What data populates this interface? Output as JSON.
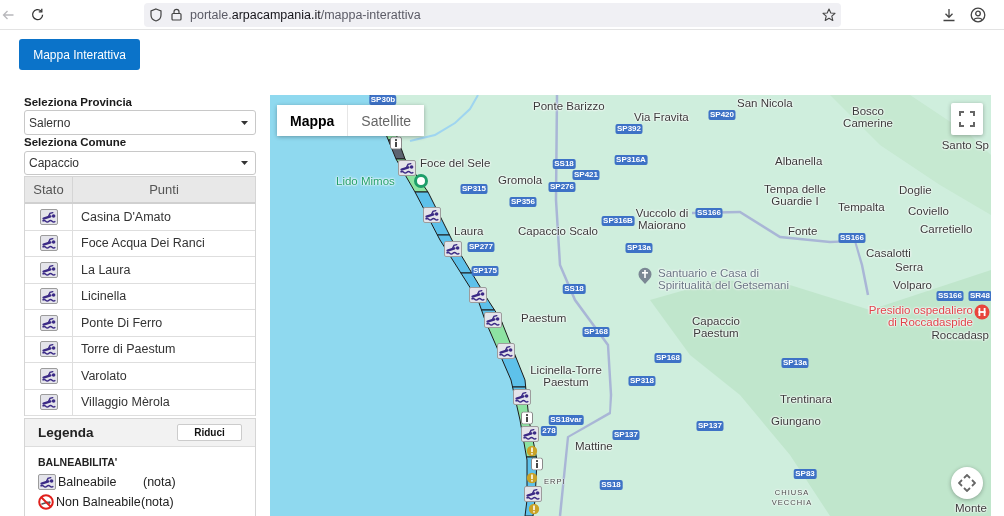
{
  "browser": {
    "back_disabled": true,
    "url": {
      "subdomain": "portale.",
      "domain": "arpacampania.it",
      "path": "/mappa-interattiva"
    }
  },
  "page_button": "Mappa Interattiva",
  "filters": [
    {
      "label": "Seleziona Provincia",
      "value": "Salerno"
    },
    {
      "label": "Seleziona Comune",
      "value": "Capaccio"
    }
  ],
  "table": {
    "columns": [
      "Stato",
      "Punti"
    ],
    "rows": [
      {
        "kind": "balneabile",
        "name": "Casina D'Amato"
      },
      {
        "kind": "balneabile",
        "name": "Foce Acqua Dei Ranci"
      },
      {
        "kind": "balneabile",
        "name": "La Laura"
      },
      {
        "kind": "balneabile",
        "name": "Licinella"
      },
      {
        "kind": "balneabile",
        "name": "Ponte Di Ferro"
      },
      {
        "kind": "balneabile",
        "name": "Torre di Paestum"
      },
      {
        "kind": "balneabile",
        "name": "Varolato"
      },
      {
        "kind": "balneabile",
        "name": "Villaggio Mèrola"
      }
    ]
  },
  "legend": {
    "title": "Legenda",
    "toggle_button": "Riduci",
    "section": "BALNEABILITA'",
    "items": [
      {
        "kind": "balneabile",
        "label": "Balneabile",
        "note": "(nota)"
      },
      {
        "kind": "non_balneabile",
        "label": "Non Balneabile",
        "note": "(nota)"
      }
    ]
  },
  "map": {
    "view_toggle": [
      {
        "label": "Mappa",
        "selected": true
      },
      {
        "label": "Satellite",
        "selected": false
      }
    ],
    "places": [
      {
        "kind": "town",
        "lines": [
          "Ponte Barizzo"
        ]
      },
      {
        "kind": "town",
        "lines": [
          "San Nicola"
        ]
      },
      {
        "kind": "town",
        "lines": [
          "Via Fravita"
        ]
      },
      {
        "kind": "town",
        "lines": [
          "Bosco",
          "Camerine"
        ]
      },
      {
        "kind": "town",
        "lines": [
          "Santo Sp"
        ]
      },
      {
        "kind": "town",
        "lines": [
          "Foce del Sele"
        ]
      },
      {
        "kind": "town",
        "lines": [
          "Albanella"
        ]
      },
      {
        "kind": "beach",
        "lines": [
          "Lido Mimos"
        ]
      },
      {
        "kind": "town",
        "lines": [
          "Gromola"
        ]
      },
      {
        "kind": "town",
        "lines": [
          "Tempa delle",
          "Guardie I"
        ]
      },
      {
        "kind": "town",
        "lines": [
          "Doglie"
        ]
      },
      {
        "kind": "town",
        "lines": [
          "Tempalta"
        ]
      },
      {
        "kind": "town",
        "lines": [
          "Vuccolo di",
          "Maiorano"
        ]
      },
      {
        "kind": "town",
        "lines": [
          "Coviello"
        ]
      },
      {
        "kind": "town",
        "lines": [
          "Laura"
        ]
      },
      {
        "kind": "town",
        "lines": [
          "Capaccio Scalo"
        ]
      },
      {
        "kind": "town",
        "lines": [
          "Fonte"
        ]
      },
      {
        "kind": "town",
        "lines": [
          "Carretiello"
        ]
      },
      {
        "kind": "town",
        "lines": [
          "Casalotti"
        ]
      },
      {
        "kind": "town",
        "lines": [
          "Serra"
        ]
      },
      {
        "kind": "town",
        "lines": [
          "Volparo"
        ]
      },
      {
        "kind": "town",
        "lines": [
          "Paestum"
        ]
      },
      {
        "kind": "town",
        "lines": [
          "Capaccio",
          "Paestum"
        ]
      },
      {
        "kind": "town",
        "lines": [
          "Roccadasp"
        ]
      },
      {
        "kind": "town",
        "lines": [
          "Licinella-Torre",
          "Paestum"
        ]
      },
      {
        "kind": "town",
        "lines": [
          "Trentinara"
        ]
      },
      {
        "kind": "town",
        "lines": [
          "Giungano"
        ]
      },
      {
        "kind": "town",
        "lines": [
          "Mattine"
        ]
      },
      {
        "kind": "locality",
        "lines": [
          "ERPI"
        ]
      },
      {
        "kind": "locality",
        "lines": [
          "CHIUSA",
          "VECCHIA"
        ]
      },
      {
        "kind": "town",
        "lines": [
          "Monte"
        ]
      }
    ],
    "pois": [
      {
        "kind": "worship",
        "lines": [
          "Santuario e Casa di",
          "Spiritualità del Getsemani"
        ]
      },
      {
        "kind": "hospital",
        "lines": [
          "Presidio ospedaliero",
          "di Roccadaspide"
        ]
      }
    ],
    "roads": [
      "SP30b",
      "SP420",
      "SP392",
      "SS18",
      "SP316A",
      "SP421",
      "SP315",
      "SP276",
      "SP356",
      "SS166",
      "SP316B",
      "SS166",
      "SP277",
      "SP13a",
      "SP175",
      "SS18",
      "SS166",
      "SR48",
      "SP168",
      "SP168",
      "SP13a",
      "SP318",
      "SS18var",
      "278",
      "SP137",
      "SP137",
      "SP83",
      "SS18"
    ]
  }
}
